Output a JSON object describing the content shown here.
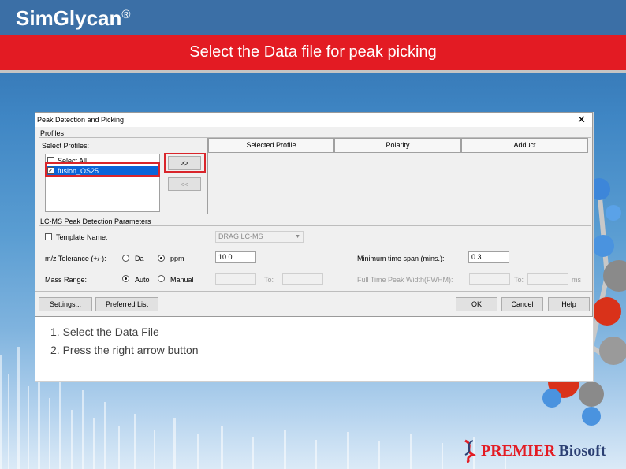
{
  "slide": {
    "brand": "SimGlycan",
    "brand_mark": "®",
    "title": "Select the Data file for peak picking",
    "logo_premier": "PREMIER",
    "logo_biosoft": "Biosoft"
  },
  "dialog": {
    "title": "Peak Detection and Picking",
    "close_glyph": "✕",
    "profiles": {
      "group_label": "Profiles",
      "select_label": "Select Profiles:",
      "items": [
        {
          "label": "Select All",
          "checked": false
        },
        {
          "label": "fusion_OS25",
          "checked": true
        }
      ],
      "add_button": ">>",
      "remove_button": "<<",
      "columns": [
        "Selected Profile",
        "Polarity",
        "Adduct"
      ]
    },
    "lcms": {
      "group_label": "LC-MS Peak Detection Parameters",
      "template_label": "Template Name:",
      "template_value": "DRAG LC-MS",
      "tolerance_label": "m/z Tolerance (+/-):",
      "da_label": "Da",
      "ppm_label": "ppm",
      "tolerance_value": "10.0",
      "min_time_label": "Minimum time span (mins.):",
      "min_time_value": "0.3",
      "mass_range_label": "Mass Range:",
      "auto_label": "Auto",
      "manual_label": "Manual",
      "to_label": "To:",
      "peak_width_label": "Full Time Peak Width(FWHM):",
      "ms_label": "ms"
    },
    "footer": {
      "settings": "Settings...",
      "preferred": "Preferred List",
      "ok": "OK",
      "cancel": "Cancel",
      "help": "Help"
    }
  },
  "instructions": {
    "step1": "1. Select the Data File",
    "step2": "2. Press the right arrow button"
  },
  "colors": {
    "banner_red": "#e31b23",
    "header_blue": "#3b6fa6",
    "selection_blue": "#0a64d8",
    "highlight_red": "#d9252b"
  }
}
